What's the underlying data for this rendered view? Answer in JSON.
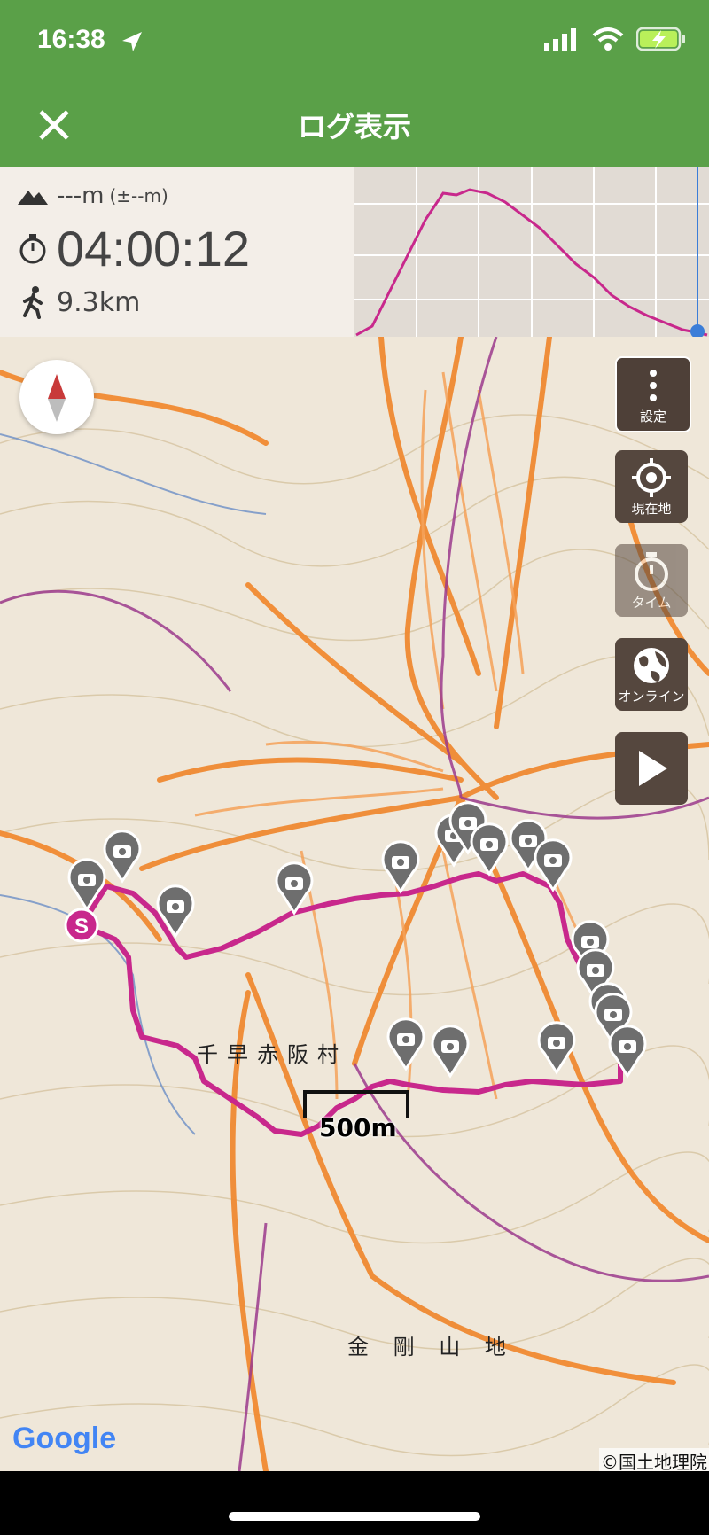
{
  "status_bar": {
    "time": "16:38"
  },
  "header": {
    "title": "ログ表示"
  },
  "stats": {
    "altitude": "---m",
    "altitude_delta": "(±--m)",
    "duration": "04:00:12",
    "distance": "9.3km"
  },
  "map": {
    "side_buttons": [
      {
        "icon": "more-vertical-icon",
        "label": "設定"
      },
      {
        "icon": "location-target-icon",
        "label": "現在地"
      },
      {
        "icon": "stopwatch-icon",
        "label": "タイム"
      },
      {
        "icon": "globe-icon",
        "label": "オンライン"
      },
      {
        "icon": "play-icon",
        "label": ""
      }
    ],
    "start_marker": "S",
    "scale": "500m",
    "village_name": "千早赤阪村",
    "mountain_label": "金 剛 山 地",
    "google_logo": "Google",
    "credit": "©国土地理院"
  },
  "colors": {
    "header_green": "#5aa048",
    "route_magenta": "#c8288c",
    "contour_orange": "#f08a32",
    "button_brown": "#55473e"
  }
}
